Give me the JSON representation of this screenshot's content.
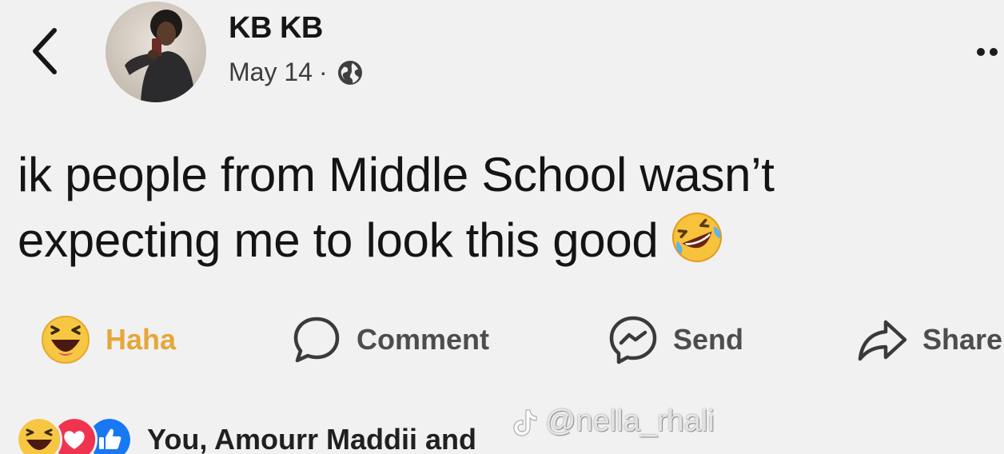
{
  "header": {
    "back_icon": "chevron-left-icon",
    "author_name": "KB KB",
    "date": "May 14",
    "separator": "·",
    "privacy_icon": "globe-icon",
    "more_icon": "more-options-icon"
  },
  "post": {
    "line1": "ik people from Middle School wasn’t",
    "line2": "expecting me to look this good",
    "emoji": "rolling-on-floor-laughing-emoji"
  },
  "actions": {
    "haha_label": "Haha",
    "comment_label": "Comment",
    "send_label": "Send",
    "share_label": "Share",
    "haha_color": "#e7a63a"
  },
  "reactions": {
    "icons": [
      "haha-icon",
      "love-icon",
      "like-icon"
    ],
    "text": "You, Amourr Maddii and"
  },
  "watermark": {
    "handle": "@nella_rhali"
  },
  "colors": {
    "background": "#f1f1f1",
    "text": "#161616",
    "like_blue": "#1877f2",
    "love_red": "#f0344f",
    "haha_yellow": "#f7c744"
  }
}
